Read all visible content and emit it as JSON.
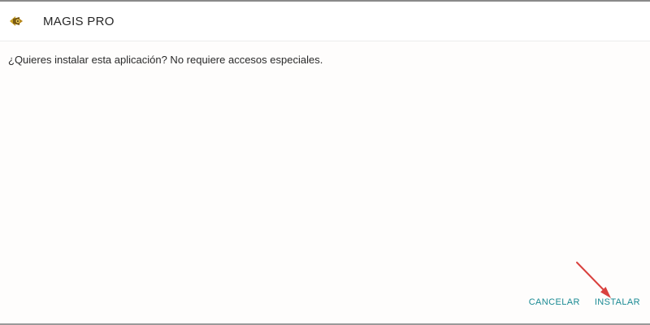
{
  "header": {
    "app_icon": "magis-app-icon",
    "title": "MAGIS PRO"
  },
  "dialog": {
    "message": "¿Quieres instalar esta aplicación? No requiere accesos especiales."
  },
  "actions": {
    "cancel_label": "CANCELAR",
    "install_label": "INSTALAR"
  },
  "annotation": {
    "icon": "red-arrow-pointer",
    "color": "#d9413e",
    "target": "install-button"
  },
  "colors": {
    "button_text": "#1a8a93",
    "title_text": "#262626",
    "body_text": "#2a2a2a"
  }
}
